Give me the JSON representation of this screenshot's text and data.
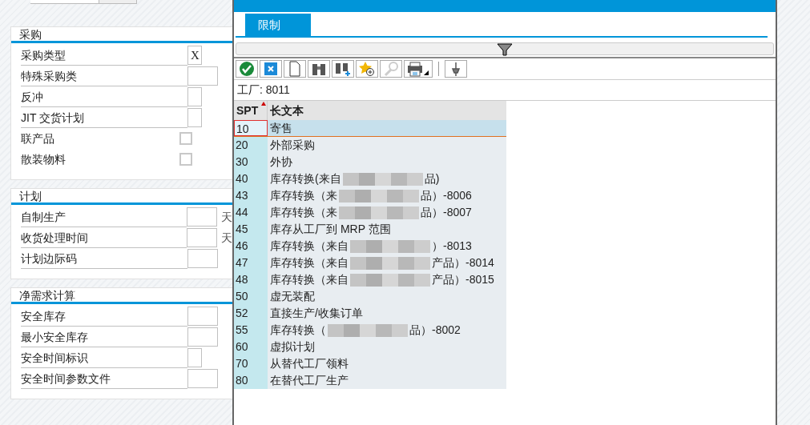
{
  "sections": [
    {
      "title": "采购",
      "fields": [
        {
          "kind": "text",
          "label": "采购类型",
          "value": "X",
          "wide": false
        },
        {
          "kind": "text",
          "label": "特殊采购类",
          "wide": true
        },
        {
          "kind": "text",
          "label": "反冲",
          "wide": false
        },
        {
          "kind": "text",
          "label": "JIT 交货计划",
          "wide": false
        },
        {
          "kind": "checkbox",
          "label": "联产品",
          "checked": false
        },
        {
          "kind": "checkbox",
          "label": "散装物料",
          "checked": false
        }
      ]
    },
    {
      "title": "计划",
      "fields": [
        {
          "kind": "text",
          "label": "自制生产",
          "wide": true,
          "unit": "天"
        },
        {
          "kind": "text",
          "label": "收货处理时间",
          "wide": true,
          "unit": "天"
        },
        {
          "kind": "text",
          "label": "计划边际码",
          "wide": true
        }
      ]
    },
    {
      "title": "净需求计算",
      "fields": [
        {
          "kind": "text",
          "label": "安全库存",
          "wide": true
        },
        {
          "kind": "text",
          "label": "最小安全库存",
          "wide": true
        },
        {
          "kind": "text",
          "label": "安全时间标识",
          "wide": false
        },
        {
          "kind": "text",
          "label": "安全时间参数文件",
          "wide": true
        }
      ]
    }
  ],
  "dialog": {
    "tabs": [
      {
        "label": "限制",
        "selected": true
      }
    ],
    "plant": "工厂: 8011",
    "columns": [
      "SPT",
      "长文本"
    ],
    "rows": [
      {
        "code": "10",
        "text": "寄售",
        "selected": true
      },
      {
        "code": "20",
        "text": "外部采购",
        "selected": false
      },
      {
        "code": "30",
        "text": "外协",
        "selected": false
      },
      {
        "code": "40",
        "text": "库存转换(来自",
        "tail": "品)",
        "selected": false
      },
      {
        "code": "43",
        "text": "库存转换（来",
        "tail": "品）-8006",
        "selected": false
      },
      {
        "code": "44",
        "text": "库存转换（来",
        "tail": "品）-8007",
        "selected": false
      },
      {
        "code": "45",
        "text": "库存从工厂到 MRP 范围",
        "selected": false
      },
      {
        "code": "46",
        "text": "库存转换（来自",
        "tail": "）-8013",
        "selected": false
      },
      {
        "code": "47",
        "text": "库存转换（来自",
        "tail": "产品）-8014",
        "selected": false
      },
      {
        "code": "48",
        "text": "库存转换（来自",
        "tail": "产品）-8015",
        "selected": false
      },
      {
        "code": "50",
        "text": "虚无装配",
        "selected": false
      },
      {
        "code": "52",
        "text": "直接生产/收集订单",
        "selected": false
      },
      {
        "code": "55",
        "text": "库存转换（",
        "tail": "品）-8002",
        "selected": false
      },
      {
        "code": "60",
        "text": "虚拟计划",
        "selected": false
      },
      {
        "code": "70",
        "text": "从替代工厂领料",
        "selected": false
      },
      {
        "code": "80",
        "text": "在替代工厂生产",
        "selected": false
      }
    ]
  }
}
